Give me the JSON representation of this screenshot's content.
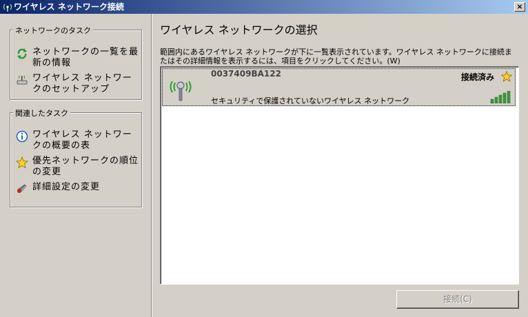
{
  "window": {
    "title": "ワイヤレス ネットワーク接続",
    "close_label": "×"
  },
  "left": {
    "network_tasks": {
      "title": "ネットワークのタスク",
      "items": [
        {
          "label": "ネットワークの一覧を最新の情報",
          "icon": "refresh-icon"
        },
        {
          "label": "ワイヤレス ネットワークのセットアップ",
          "icon": "wireless-setup-icon"
        }
      ]
    },
    "related_tasks": {
      "title": "関連したタスク",
      "items": [
        {
          "label": "ワイヤレス ネットワークの概要の表",
          "icon": "info-icon"
        },
        {
          "label": "優先ネットワークの順位の変更",
          "icon": "star-icon"
        },
        {
          "label": "詳細設定の変更",
          "icon": "settings-icon"
        }
      ]
    }
  },
  "main": {
    "heading": "ワイヤレス ネットワークの選択",
    "description": "範囲内にあるワイヤレス ネットワークが下に一覧表示されています。ワイヤレス ネットワークに接続またはその詳細情報を表示するには、項目をクリックしてください。(W)",
    "networks": [
      {
        "ssid": "0037409BA122",
        "status": "接続済み",
        "security": "セキュリティで保護されていないワイヤレス ネットワーク",
        "signal_bars": 5,
        "preferred": true
      }
    ],
    "connect_button": "接続(C)"
  },
  "colors": {
    "titlebar_start": "#0a246a",
    "titlebar_end": "#a6caf0",
    "signal_green": "#2aa02a"
  }
}
